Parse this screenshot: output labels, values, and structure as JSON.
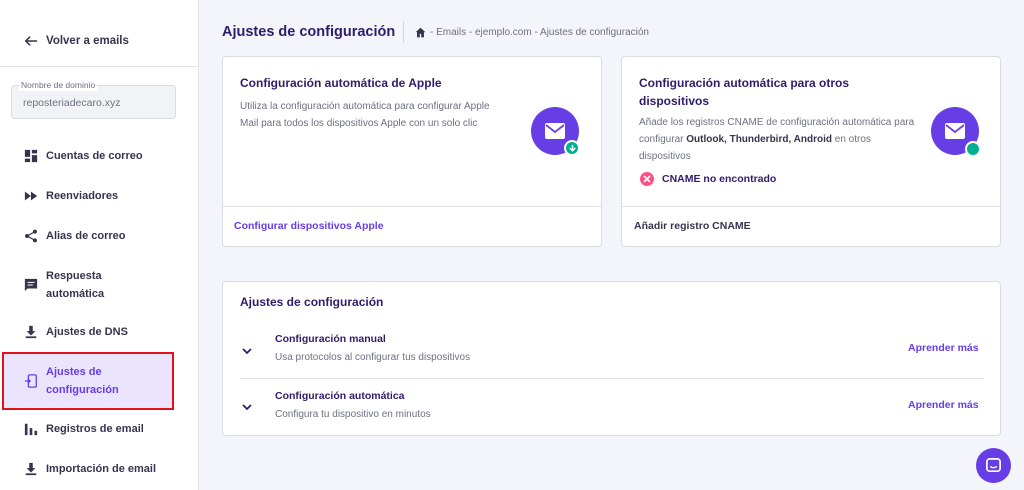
{
  "sidebar": {
    "back_label": "Volver a emails",
    "domain_label": "Nombre de dominio",
    "domain_value": "reposteriadecaro.xyz",
    "items": [
      {
        "label": "Cuentas de correo",
        "icon": "dashboard-icon"
      },
      {
        "label": "Reenviadores",
        "icon": "fast-forward-icon"
      },
      {
        "label": "Alias de correo",
        "icon": "share-icon"
      },
      {
        "label": "Respuesta automática",
        "icon": "chat-reply-icon"
      },
      {
        "label": "Ajustes de DNS",
        "icon": "download-icon"
      },
      {
        "label": "Ajustes de configuración",
        "icon": "phone-setup-icon",
        "active": true
      },
      {
        "label": "Registros de email",
        "icon": "bar-chart-icon"
      },
      {
        "label": "Importación de email",
        "icon": "import-icon"
      }
    ]
  },
  "header": {
    "title": "Ajustes de configuración",
    "breadcrumb": "- Emails - ejemplo.com - Ajustes de configuración"
  },
  "apple_card": {
    "title": "Configuración automática de Apple",
    "desc": "Utiliza la configuración automática para configurar Apple Mail para todos los dispositivos Apple con un solo clic",
    "link": "Configurar dispositivos Apple"
  },
  "other_card": {
    "title": "Configuración automática para otros dispositivos",
    "desc_prefix": "Añade los registros CNAME de configuración automática para configurar ",
    "desc_bold": "Outlook, Thunderbird, Android",
    "desc_suffix": " en otros dispositivos",
    "status": "CNAME no encontrado",
    "link": "Añadir registro CNAME"
  },
  "settings_card": {
    "title": "Ajustes de configuración",
    "rows": [
      {
        "title": "Configuración manual",
        "subtitle": "Usa protocolos al configurar tus dispositivos",
        "link": "Aprender más"
      },
      {
        "title": "Configuración automática",
        "subtitle": "Configura tu dispositivo en minutos",
        "link": "Aprender más"
      }
    ]
  },
  "colors": {
    "accent": "#673de6",
    "success": "#00b090",
    "error": "#fc5185",
    "active_bg": "#ebe4ff",
    "highlight_border": "#e2121b"
  }
}
